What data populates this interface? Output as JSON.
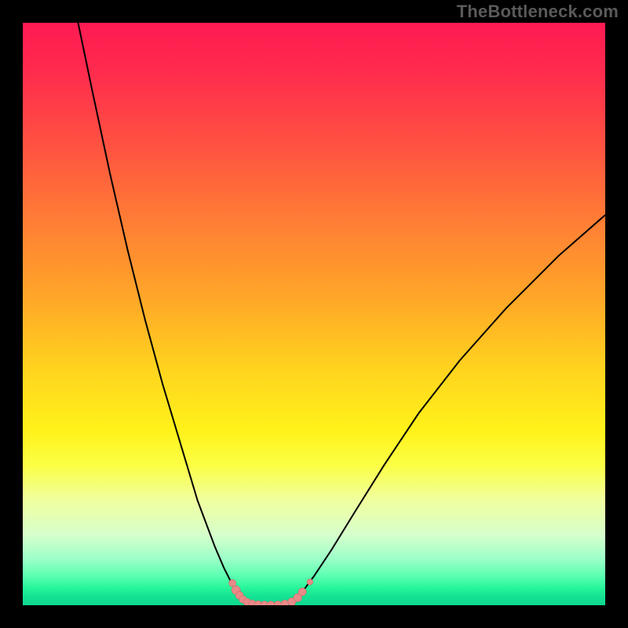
{
  "watermark": "TheBottleneck.com",
  "colors": {
    "frame_bg": "#000000",
    "curve_stroke": "#000000",
    "marker_fill": "#e98a88",
    "marker_stroke": "#d06a6a"
  },
  "chart_data": {
    "type": "line",
    "title": "",
    "xlabel": "",
    "ylabel": "",
    "xlim": [
      0,
      100
    ],
    "ylim": [
      0,
      100
    ],
    "series": [
      {
        "name": "left-branch",
        "x": [
          9.5,
          12,
          15,
          18,
          21,
          24,
          27,
          30,
          31.5,
          33,
          34.5,
          36,
          37,
          38,
          39
        ],
        "y": [
          100,
          88,
          74,
          61,
          49,
          38,
          28,
          18,
          14,
          10,
          6.5,
          3.5,
          2,
          1,
          0.3
        ]
      },
      {
        "name": "valley-floor",
        "x": [
          39,
          40,
          41,
          42,
          43,
          44,
          45,
          46,
          47
        ],
        "y": [
          0.3,
          0.15,
          0.1,
          0.08,
          0.08,
          0.12,
          0.25,
          0.6,
          1.3
        ]
      },
      {
        "name": "right-branch",
        "x": [
          47,
          48,
          50,
          53,
          57,
          62,
          68,
          75,
          83,
          92,
          100
        ],
        "y": [
          1.3,
          2.3,
          5,
          9.5,
          16,
          24,
          33,
          42,
          51,
          60,
          67
        ]
      }
    ],
    "markers": [
      {
        "x": 36.0,
        "y": 3.8,
        "r": 4.5
      },
      {
        "x": 36.6,
        "y": 2.6,
        "r": 5.5
      },
      {
        "x": 37.2,
        "y": 1.7,
        "r": 5.0
      },
      {
        "x": 37.8,
        "y": 1.0,
        "r": 4.8
      },
      {
        "x": 38.5,
        "y": 0.55,
        "r": 4.8
      },
      {
        "x": 39.4,
        "y": 0.28,
        "r": 4.6
      },
      {
        "x": 40.4,
        "y": 0.15,
        "r": 4.6
      },
      {
        "x": 41.5,
        "y": 0.1,
        "r": 4.6
      },
      {
        "x": 42.6,
        "y": 0.09,
        "r": 4.6
      },
      {
        "x": 43.8,
        "y": 0.12,
        "r": 4.6
      },
      {
        "x": 45.0,
        "y": 0.25,
        "r": 4.8
      },
      {
        "x": 46.2,
        "y": 0.6,
        "r": 5.0
      },
      {
        "x": 47.2,
        "y": 1.3,
        "r": 5.2
      },
      {
        "x": 48.0,
        "y": 2.3,
        "r": 5.0
      },
      {
        "x": 49.3,
        "y": 4.0,
        "r": 3.8
      }
    ]
  }
}
